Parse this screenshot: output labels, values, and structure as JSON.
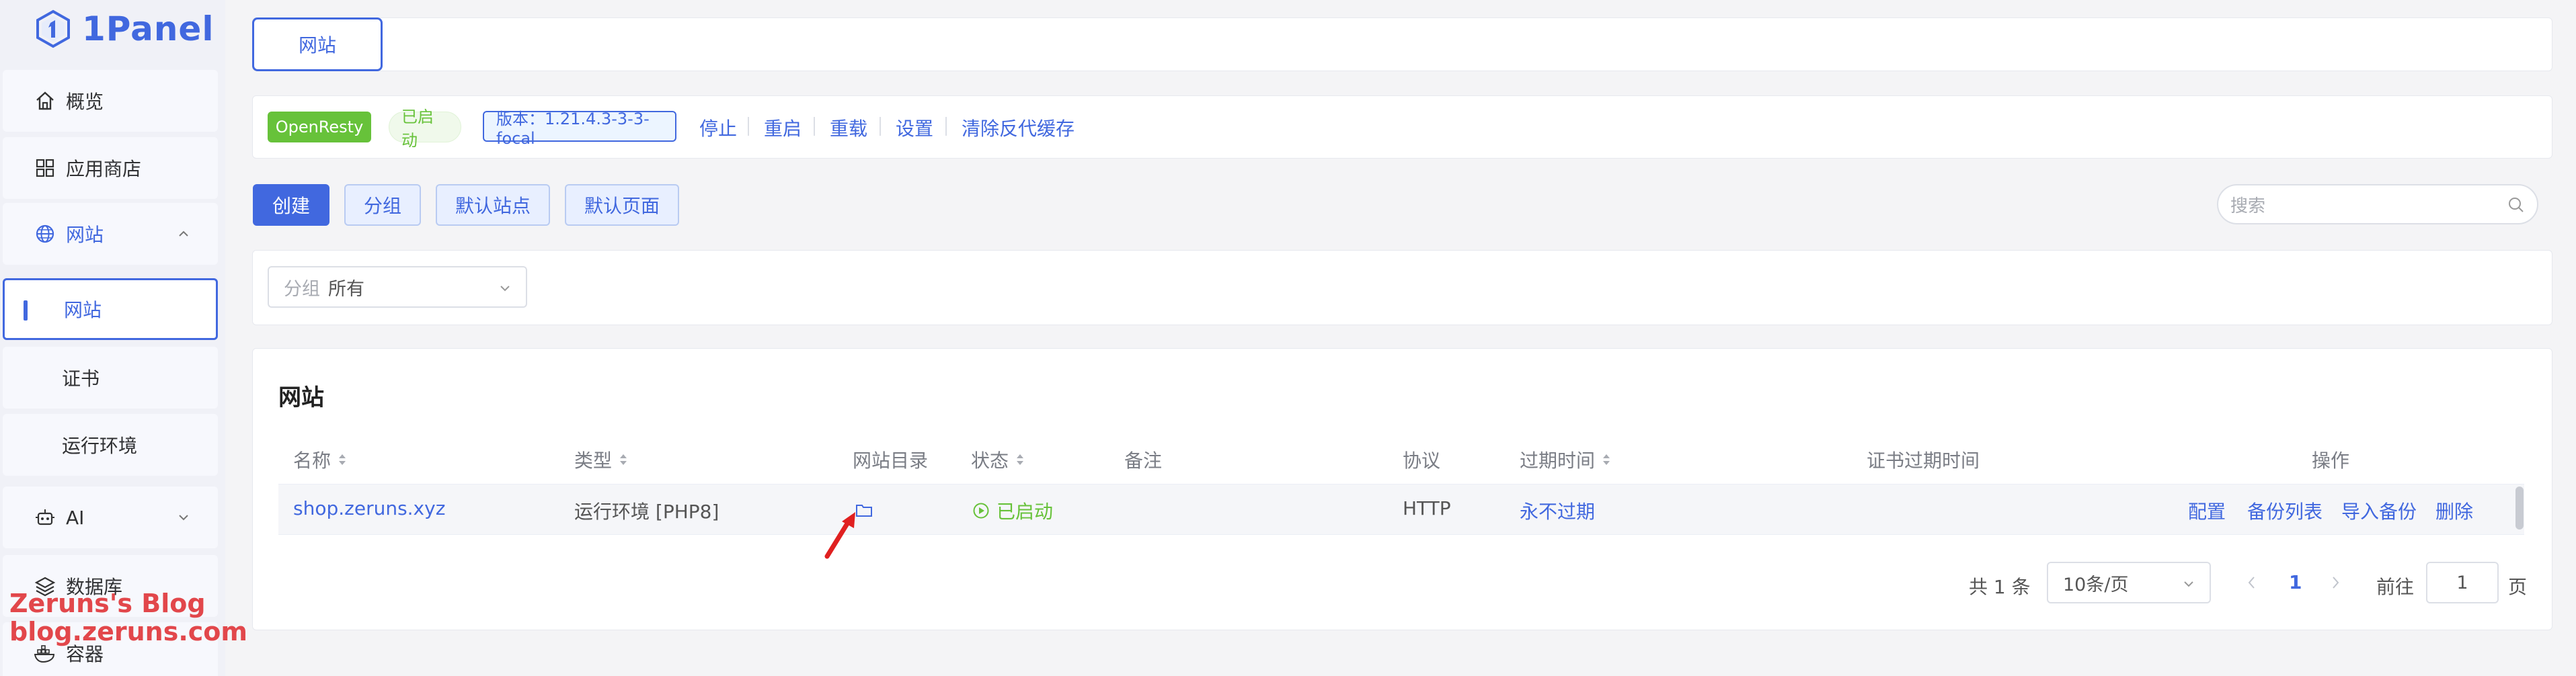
{
  "app": {
    "name": "1Panel"
  },
  "sidebar": {
    "items": [
      {
        "label": "概览",
        "icon": "home-icon"
      },
      {
        "label": "应用商店",
        "icon": "grid-icon"
      },
      {
        "label": "网站",
        "icon": "globe-icon",
        "expanded": true
      },
      {
        "label": "网站",
        "active": true
      },
      {
        "label": "证书"
      },
      {
        "label": "运行环境"
      },
      {
        "label": "AI",
        "icon": "robot-icon"
      },
      {
        "label": "数据库",
        "icon": "layers-icon"
      },
      {
        "label": "容器",
        "icon": "docker-icon"
      }
    ]
  },
  "watermark": {
    "line1": "Zeruns's Blog",
    "line2": "blog.zeruns.com"
  },
  "tabs": {
    "active": "网站"
  },
  "server": {
    "name": "OpenResty",
    "status": "已启动",
    "version": "版本：1.21.4.3-3-3-focal",
    "actions": [
      "停止",
      "重启",
      "重载",
      "设置",
      "清除反代缓存"
    ]
  },
  "toolbar": {
    "create": "创建",
    "group": "分组",
    "default_site": "默认站点",
    "default_page": "默认页面",
    "search_placeholder": "搜索"
  },
  "filter": {
    "label": "分组",
    "value": "所有"
  },
  "table": {
    "title": "网站",
    "headers": {
      "name": "名称",
      "type": "类型",
      "dir": "网站目录",
      "status": "状态",
      "remark": "备注",
      "protocol": "协议",
      "expire": "过期时间",
      "cert_expire": "证书过期时间",
      "actions": "操作"
    },
    "rows": [
      {
        "name": "shop.zeruns.xyz",
        "type": "运行环境 [PHP8]",
        "status": "已启动",
        "remark": "",
        "protocol": "HTTP",
        "expire": "永不过期",
        "cert_expire": "",
        "actions": [
          "配置",
          "备份列表",
          "导入备份",
          "删除"
        ]
      }
    ]
  },
  "pagination": {
    "total": "共 1 条",
    "page_size": "10条/页",
    "current": "1",
    "goto_label": "前往",
    "goto_value": "1",
    "page_unit": "页"
  },
  "colors": {
    "accent": "#4168df",
    "success": "#67c23a",
    "watermark": "#e2474b"
  }
}
